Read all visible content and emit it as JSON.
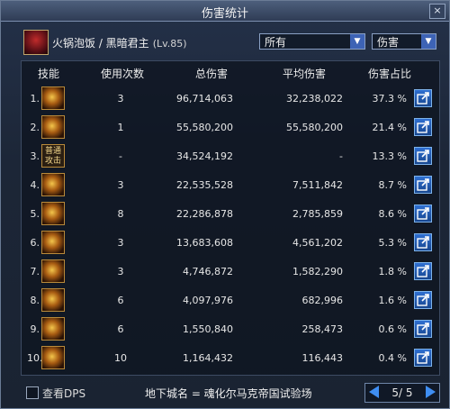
{
  "window": {
    "title": "伤害统计",
    "close": "×"
  },
  "character": {
    "name": "火锅泡饭 / 黑暗君主",
    "level": "(Lv.85)"
  },
  "filters": {
    "target": "所有",
    "metric": "伤害"
  },
  "columns": {
    "skill": "技能",
    "count": "使用次数",
    "total": "总伤害",
    "avg": "平均伤害",
    "pct": "伤害占比"
  },
  "rows": [
    {
      "no": "1.",
      "icon": "flame-slash-skill-icon",
      "icon_text": "",
      "count": "3",
      "total": "96,714,063",
      "avg": "32,238,022",
      "pct": "37.3 %"
    },
    {
      "no": "2.",
      "icon": "dragon-flame-skill-icon",
      "icon_text": "",
      "count": "1",
      "total": "55,580,200",
      "avg": "55,580,200",
      "pct": "21.4 %"
    },
    {
      "no": "3.",
      "icon": "normal-attack-icon",
      "icon_text": "普通\n攻击",
      "count": "-",
      "total": "34,524,192",
      "avg": "-",
      "pct": "13.3 %"
    },
    {
      "no": "4.",
      "icon": "eye-rune-skill-icon",
      "icon_text": "",
      "count": "3",
      "total": "22,535,528",
      "avg": "7,511,842",
      "pct": "8.7 %"
    },
    {
      "no": "5.",
      "icon": "pierce-skill-icon",
      "icon_text": "",
      "count": "8",
      "total": "22,286,878",
      "avg": "2,785,859",
      "pct": "8.6 %"
    },
    {
      "no": "6.",
      "icon": "vortex-skill-icon",
      "icon_text": "",
      "count": "3",
      "total": "13,683,608",
      "avg": "4,561,202",
      "pct": "5.3 %"
    },
    {
      "no": "7.",
      "icon": "claw-skill-icon",
      "icon_text": "",
      "count": "3",
      "total": "4,746,872",
      "avg": "1,582,290",
      "pct": "1.8 %"
    },
    {
      "no": "8.",
      "icon": "orb-skill-icon",
      "icon_text": "",
      "count": "6",
      "total": "4,097,976",
      "avg": "682,996",
      "pct": "1.6 %"
    },
    {
      "no": "9.",
      "icon": "wave-skill-icon",
      "icon_text": "",
      "count": "6",
      "total": "1,550,840",
      "avg": "258,473",
      "pct": "0.6 %"
    },
    {
      "no": "10.",
      "icon": "crescent-skill-icon",
      "icon_text": "",
      "count": "10",
      "total": "1,164,432",
      "avg": "116,443",
      "pct": "0.4 %"
    }
  ],
  "footer": {
    "view_dps": "查看DPS",
    "location": "地下城名 = 魂化尔马克帝国试验场",
    "page": "5/ 5"
  }
}
